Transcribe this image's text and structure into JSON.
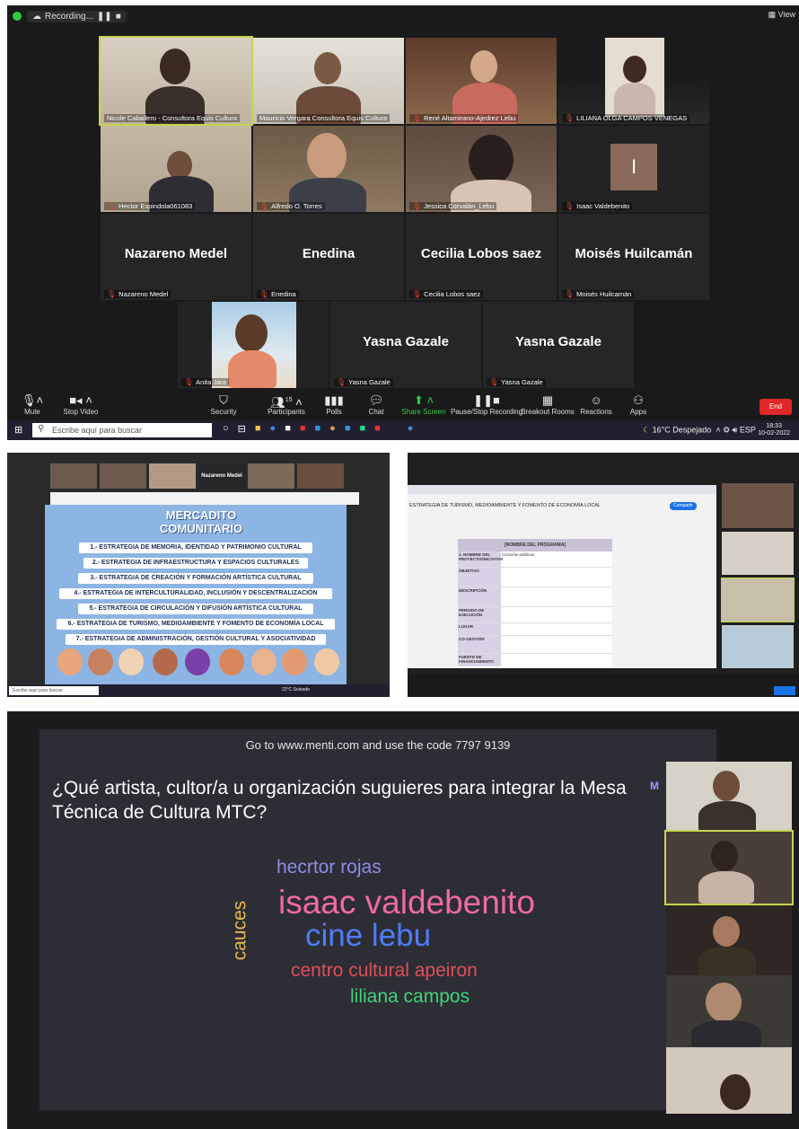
{
  "zoom": {
    "recording_label": "Recording...",
    "view_label": "View",
    "participants": [
      {
        "name": "Nicole Caballero - Consultora Equis Cultura",
        "muted": false
      },
      {
        "name": "Mauricio Vergara Consultora Equis Cultura",
        "muted": false
      },
      {
        "name": "René Altamirano-Ajedrez Lebu",
        "muted": true
      },
      {
        "name": "LILIANA OLGA CAMPOS VENEGAS",
        "muted": true
      },
      {
        "name": "Hector Espindola061083",
        "muted": true
      },
      {
        "name": "Alfredo O. Torres",
        "muted": true
      },
      {
        "name": "Jessica Corvalán_Lebu",
        "muted": true
      },
      {
        "name": "Isaac Valdebenito",
        "muted": true
      },
      {
        "name": "Nazareno Medel",
        "big": "Nazareno Medel",
        "muted": true
      },
      {
        "name": "Enedina",
        "big": "Enedina",
        "muted": true
      },
      {
        "name": "Cecilia Lobos saez",
        "big": "Cecilia Lobos saez",
        "muted": true
      },
      {
        "name": "Moisés Huilcamán",
        "big": "Moisés Huilcamán",
        "muted": true
      },
      {
        "name": "Anita Jara",
        "muted": true
      },
      {
        "name": "Yasna Gazale",
        "big": "Yasna Gazale",
        "muted": true
      },
      {
        "name": "Yasna Gazale",
        "big": "Yasna Gazale",
        "muted": true
      }
    ],
    "isaac_initial": "I",
    "toolbar": {
      "mute": "Mute",
      "stop_video": "Stop Video",
      "security": "Security",
      "participants": "Participants",
      "participants_count": "15",
      "polls": "Polls",
      "chat": "Chat",
      "share_screen": "Share Screen",
      "pause_recording": "Pause/Stop Recording",
      "breakout": "Breakout Rooms",
      "reactions": "Reactions",
      "apps": "Apps",
      "end": "End"
    },
    "taskbar": {
      "search_placeholder": "Escribe aquí para buscar",
      "weather": "16°C Despejado",
      "lang": "ESP",
      "time": "18:33",
      "date": "10-02-2022"
    },
    "colors": {
      "accent_green": "#2ecc40",
      "end_red": "#e02828",
      "active_border": "#c3d64f"
    }
  },
  "panel2": {
    "tiles": [
      "Nazareno Medel"
    ],
    "slide_title": "MERCADITO COMUNITARIO",
    "strategies": [
      "1.- ESTRATEGIA DE MEMORIA, IDENTIDAD Y PATRIMONIO CULTURAL",
      "2.- ESTRATEGIA DE INFRAESTRUCTURA Y ESPACIOS CULTURALES",
      "3.- ESTRATEGIA DE CREACIÓN Y FORMACIÓN ARTÍSTICA CULTURAL",
      "4.- ESTRATEGIA DE INTERCULTURALIDAD, INCLUSIÓN Y DESCENTRALIZACIÓN",
      "5.- ESTRATEGIA DE CIRCULACIÓN Y DIFUSIÓN ARTÍSTICA CULTURAL",
      "6.- ESTRATEGIA DE TURISMO, MEDIOAMBIENTE Y FOMENTO DE ECONOMÍA LOCAL",
      "7.- ESTRATEGIA DE ADMINISTRACIÓN, GESTIÓN CULTURAL Y ASOCIATIVIDAD"
    ],
    "search_placeholder": "Escribe aquí para buscar",
    "weather": "22°C Soleado"
  },
  "panel3": {
    "doc_title": "ESTRATEGIA DE TURISMO, MEDIOAMBIENTE Y FOMENTO DE ECONOMÍA LOCAL",
    "sheet_header": "[NOMBRE DEL PROGRAMA]",
    "rows": [
      {
        "k": "1. NOMBRE DEL PROYECTO/INICIATIVA",
        "v": "Ciclovías públicas"
      },
      {
        "k": "OBJETIVO",
        "v": ""
      },
      {
        "k": "DESCRIPCIÓN",
        "v": ""
      },
      {
        "k": "PERIODO DE EJECUCIÓN",
        "v": ""
      },
      {
        "k": "LUGAR",
        "v": ""
      },
      {
        "k": "CO-GESTIÓN",
        "v": ""
      },
      {
        "k": "FUENTE DE FINANCIAMIENTO",
        "v": ""
      }
    ],
    "share_button": "Compartir"
  },
  "menti": {
    "instruction": "Go to www.menti.com and use the code 7797 9139",
    "question": "¿Qué artista, cultor/a u organización suguieres para integrar la Mesa Técnica de Cultura MTC?",
    "logo": "M",
    "words": [
      {
        "text": "hecrtor rojas",
        "color": "#8b8fe6"
      },
      {
        "text": "isaac valdebenito",
        "color": "#f06aa0"
      },
      {
        "text": "cine lebu",
        "color": "#4f7df5"
      },
      {
        "text": "centro cultural apeiron",
        "color": "#e04f5a"
      },
      {
        "text": "liliana campos",
        "color": "#3fd47a"
      },
      {
        "text": "cauces",
        "color": "#e8b84a"
      }
    ]
  }
}
